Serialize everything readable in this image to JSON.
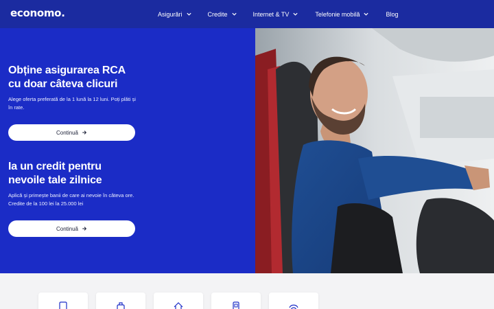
{
  "brand": {
    "logo_text": "economo."
  },
  "nav": {
    "items": [
      {
        "label": "Asigurări",
        "has_dropdown": true
      },
      {
        "label": "Credite",
        "has_dropdown": true
      },
      {
        "label": "Internet & TV",
        "has_dropdown": true
      },
      {
        "label": "Telefonie mobilă",
        "has_dropdown": true
      },
      {
        "label": "Blog",
        "has_dropdown": false
      }
    ]
  },
  "hero": {
    "offers": [
      {
        "title_line1": "Obține asigurarea RCA",
        "title_line2": "cu doar câteva clicuri",
        "description": "Alege oferta preferată de la 1 lună la 12 luni. Poți plăti și în rate.",
        "button_label": "Continuă"
      },
      {
        "title_line1": "Ia un credit pentru",
        "title_line2": "nevoile tale zilnice",
        "description": "Aplică și primește banii de care ai nevoie în câteva ore. Credite de la 100 lei la 25.000 lei",
        "button_label": "Continuă"
      }
    ],
    "image_icon": "smiling-driver-photo"
  },
  "categories": {
    "icons": [
      "document-icon",
      "luggage-icon",
      "home-icon",
      "phone-icon",
      "globe-icon"
    ]
  },
  "colors": {
    "topbar": "#1b2ba0",
    "hero_panel": "#1b2cc6",
    "button_bg": "#ffffff",
    "page_bg": "#f3f3f5"
  }
}
